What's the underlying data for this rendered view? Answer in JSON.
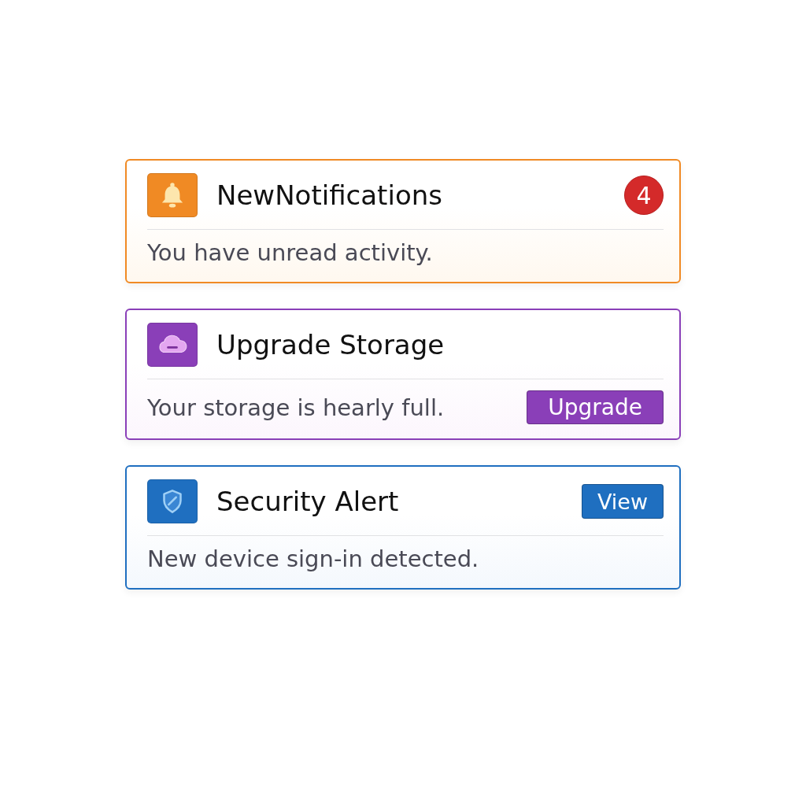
{
  "cards": [
    {
      "kind": "notifications",
      "color": "#f08a24",
      "title": "NewNotifications",
      "badge": "4",
      "message": "You have unread activity."
    },
    {
      "kind": "storage",
      "color": "#8a3fb8",
      "title": "Upgrade Storage",
      "message": "Your storage is hearly full.",
      "footer_button": "Upgrade"
    },
    {
      "kind": "security",
      "color": "#1f6fc0",
      "title": "Security Alert",
      "header_button": "View",
      "message": "New device sign-in detected."
    }
  ]
}
